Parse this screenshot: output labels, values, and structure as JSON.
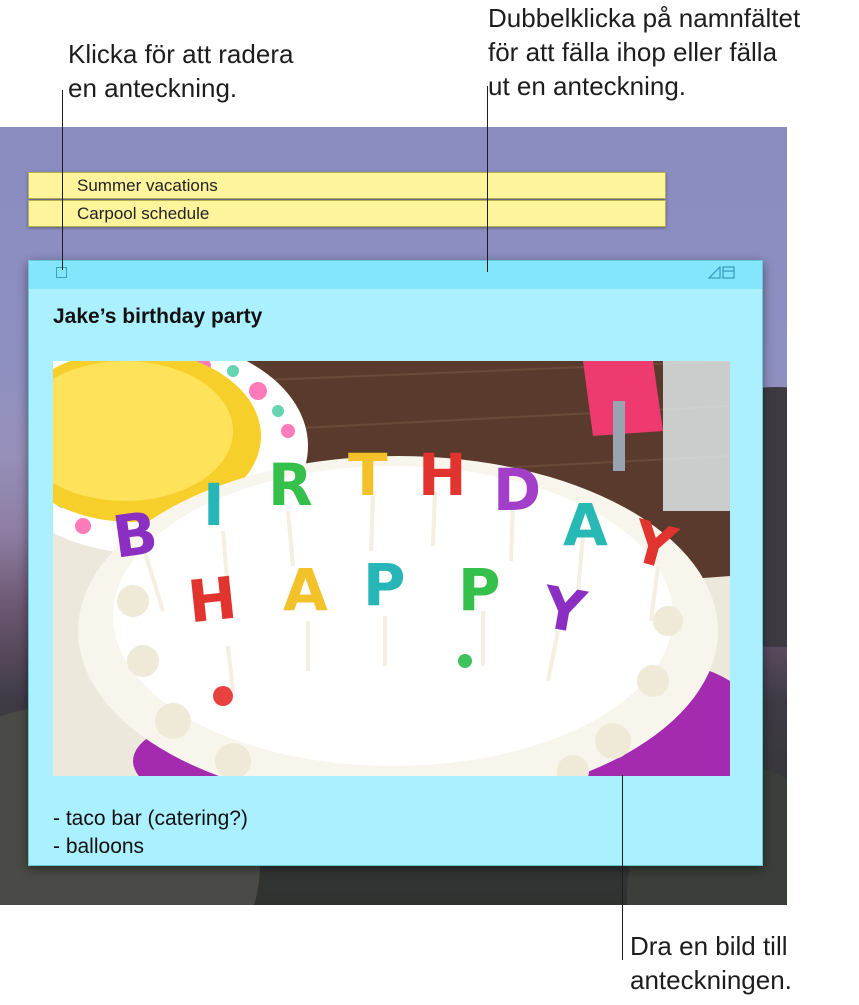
{
  "callouts": {
    "delete_note": [
      "Klicka för att radera",
      "en anteckning."
    ],
    "collapse_note": [
      "Dubbelklicka på namnfältet",
      "för att fälla ihop eller fälla",
      "ut en anteckning."
    ],
    "drag_image": [
      "Dra en bild till",
      "anteckningen."
    ]
  },
  "notes": {
    "collapsed": [
      {
        "title": "Summer vacations"
      },
      {
        "title": "Carpool schedule"
      }
    ],
    "expanded": {
      "color": "#abf0fe",
      "titlebar_color": "#83e6fb",
      "heading": "Jake’s birthday party",
      "image": {
        "subject": "birthday cake with letter candles",
        "candles_top": [
          "B",
          "I",
          "R",
          "T",
          "H",
          "D",
          "A",
          "Y"
        ],
        "candles_bottom": [
          "H",
          "A",
          "P",
          "P",
          "Y"
        ]
      },
      "items": [
        "- taco bar (catering?)",
        "- balloons"
      ]
    }
  },
  "icons": {
    "close": "close-box-icon",
    "resize": "resize-triangle-icon",
    "collapse": "collapse-window-icon"
  },
  "colors": {
    "yellow_note": "#fdf49c",
    "blue_note": "#abf0fe"
  }
}
